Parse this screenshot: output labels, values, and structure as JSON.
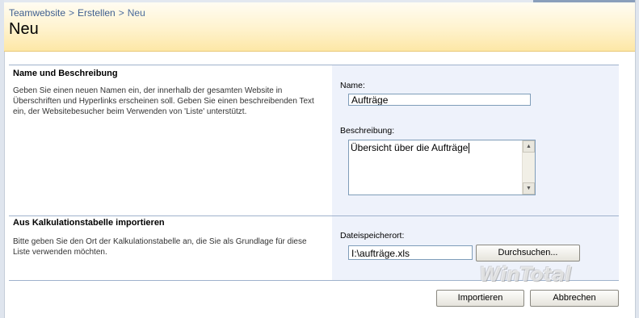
{
  "breadcrumb": {
    "items": [
      "Teamwebsite",
      "Erstellen",
      "Neu"
    ],
    "separator": ">"
  },
  "page_title": "Neu",
  "section_name": {
    "title": "Name und Beschreibung",
    "description": "Geben Sie einen neuen Namen ein, der innerhalb der gesamten Website in Überschriften und Hyperlinks erscheinen soll. Geben Sie einen beschreibenden Text ein, der Websitebesucher beim Verwenden von 'Liste' unterstützt.",
    "name_label": "Name:",
    "name_value": "Aufträge",
    "desc_label": "Beschreibung:",
    "desc_value": "Übersicht über die Aufträge"
  },
  "section_import": {
    "title": "Aus Kalkulationstabelle importieren",
    "description": "Bitte geben Sie den Ort der Kalkulationstabelle an, die Sie als Grundlage für diese Liste verwenden möchten.",
    "file_label": "Dateispeicherort:",
    "file_value": "I:\\aufträge.xls",
    "browse_label": "Durchsuchen..."
  },
  "actions": {
    "import_label": "Importieren",
    "cancel_label": "Abbrechen"
  },
  "watermark": "WinTotal",
  "colors": {
    "header_gradient_bottom": "#fde7a6",
    "breadcrumb_link": "#3f5f8f",
    "input_panel": "#eef2fb",
    "divider": "#9fb2cc"
  }
}
